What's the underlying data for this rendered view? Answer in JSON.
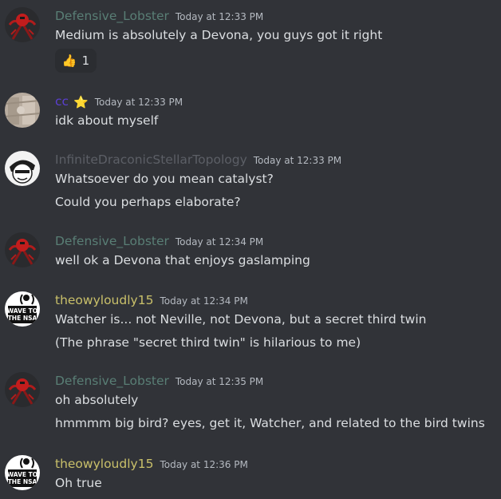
{
  "messages": [
    {
      "username": "Defensive_Lobster",
      "username_color": "#597e75",
      "timestamp": "Today at 12:33 PM",
      "avatar_icon": "red-lobster-avatar",
      "lines": [
        "Medium is absolutely a Devona, you guys got it right"
      ],
      "reaction": {
        "emoji": "👍",
        "count": "1"
      }
    },
    {
      "username": "cc",
      "username_color": "#5b3fd1",
      "badge_icon": "star-icon",
      "timestamp": "Today at 12:33 PM",
      "avatar_icon": "fabric-avatar",
      "lines": [
        "idk about myself"
      ]
    },
    {
      "username": "InfiniteDraconicStellarTopology",
      "username_color": "#5c5f66",
      "timestamp": "Today at 12:33 PM",
      "avatar_icon": "sketch-face-avatar",
      "lines": [
        "Whatsoever do you mean catalyst?",
        "Could you perhaps elaborate?"
      ]
    },
    {
      "username": "Defensive_Lobster",
      "username_color": "#597e75",
      "timestamp": "Today at 12:34 PM",
      "avatar_icon": "red-lobster-avatar",
      "lines": [
        "well ok a Devona that enjoys gaslamping"
      ]
    },
    {
      "username": "theowyloudly15",
      "username_color": "#c9c06a",
      "timestamp": "Today at 12:34 PM",
      "avatar_icon": "wave-to-the-nsa-avatar",
      "avatar_text": [
        "WAVE TO",
        "THE NSA"
      ],
      "lines": [
        "Watcher is... not Neville, not Devona, but a secret third twin",
        "(The phrase \"secret third twin\" is hilarious to me)"
      ]
    },
    {
      "username": "Defensive_Lobster",
      "username_color": "#597e75",
      "timestamp": "Today at 12:35 PM",
      "avatar_icon": "red-lobster-avatar",
      "lines": [
        "oh absolutely",
        "hmmmm big bird? eyes, get it, Watcher, and related to the bird twins"
      ]
    },
    {
      "username": "theowyloudly15",
      "username_color": "#c9c06a",
      "timestamp": "Today at 12:36 PM",
      "avatar_icon": "wave-to-the-nsa-avatar",
      "avatar_text": [
        "WAVE TO",
        "THE NSA"
      ],
      "lines": [
        "Oh true"
      ]
    }
  ]
}
